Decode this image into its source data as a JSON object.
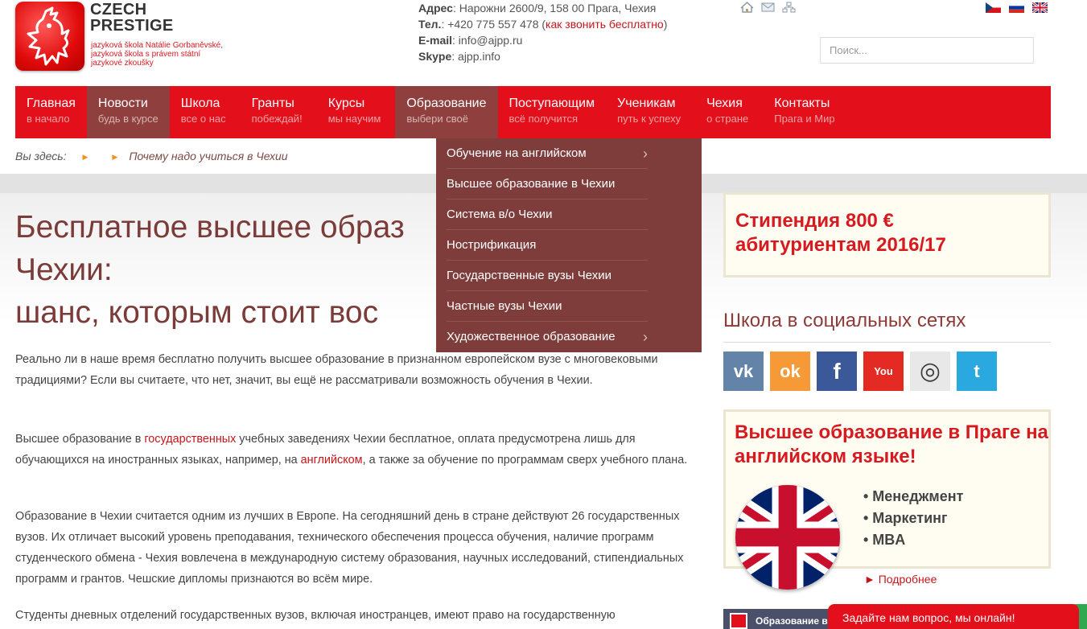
{
  "brand": {
    "line1": "CZECH",
    "line2": "PRESTIGE",
    "sub1": "jazyková škola Natálie Gorbaněvské,",
    "sub2": "jazyková škola s právem státní",
    "sub3": "jazykové zkoušky"
  },
  "contacts": {
    "address_label": "Адрес",
    ":address": "",
    "address": ": Нарожни 2600/9, 158 00 Прага, Чехия",
    "tel_label": "Тел.",
    "tel": ": +420 775 557 478 (",
    "tel_link": "как звонить бесплатно",
    "tel_end": ")",
    "email_label": "E-mail",
    "email": ": info@ajpp.ru",
    "skype_label": "Skype",
    "skype": ": ajpp.info"
  },
  "search": {
    "placeholder": "Поиск..."
  },
  "nav": [
    {
      "title": "Главная",
      "sub": "в начало"
    },
    {
      "title": "Новости",
      "sub": "будь в курсе"
    },
    {
      "title": "Школа",
      "sub": "все о нас"
    },
    {
      "title": "Гранты",
      "sub": "побеждай!"
    },
    {
      "title": "Курсы",
      "sub": "мы научим"
    },
    {
      "title": "Образование",
      "sub": "выбери своё"
    },
    {
      "title": "Поступающим",
      "sub": "всё получится"
    },
    {
      "title": "Ученикам",
      "sub": "путь к успеху"
    },
    {
      "title": "Чехия",
      "sub": "о стране"
    },
    {
      "title": "Контакты",
      "sub": "Прага и Мир"
    }
  ],
  "dropdown": [
    "Обучение на английском",
    "Высшее образование в Чехии",
    "Система в/о Чехии",
    "Нострификация",
    "Государственные вузы Чехии",
    "Частные вузы Чехии",
    "Художественное образование"
  ],
  "breadcrumb": {
    "label": "Вы здесь:",
    "current": "Почему надо учиться в Чехии"
  },
  "heading": {
    "line1": "Бесплатное высшее образ",
    "line2": "Чехии:",
    "line3": "шанс, которым стоит вос"
  },
  "paragraphs": {
    "p1": "Реально ли в наше время бесплатно получить высшее образование в признанном европейском вузе с многовековыми традициями? Если вы считаете, что нет, значит, вы ещё не рассматривали возможность обучения в Чехии.",
    "p2a": "Высшее образование в ",
    "p2link1": "государственных",
    "p2b": " учебных заведениях Чехии бесплатное, оплата предусмотрена лишь для обучающихся на иностранных языках, например, на ",
    "p2link2": "английском",
    "p2c": ", а также за обучение по программам сверх учебного плана.",
    "p3": "Образование в Чехии считается одним из лучших в Европе. На сегодняшний день в стране действуют 26 государственных вузов. Их отличает высокий уровень преподавания, технического обеспечения процесса обучения, наличие программ студенческого обмена - Чехия вовлечена в международную систему образования, научных исследований, стипендиальных программ и грантов. Чешские дипломы признаются во всём мире.",
    "p4": "Студенты дневных отделений государственных вузов, включая иностранцев, имеют право на государственную"
  },
  "promo1": {
    "line1": "Стипендия 800 €",
    "line2": "абитуриентам 2016/17"
  },
  "social": {
    "title": "Школа в социальных сетях",
    "icons": [
      "vk-icon",
      "odnoklassniki-icon",
      "facebook-icon",
      "youtube-icon",
      "instagram-icon",
      "twitter-icon"
    ],
    "glyphs": [
      "vk",
      "ok",
      "f",
      "You",
      "◎",
      "t"
    ],
    "colors": [
      "#6383a8",
      "#f59a36",
      "#3b5998",
      "#e32b24",
      "#3d3d3d",
      "#2aa9e0"
    ]
  },
  "promo2": {
    "title": "Высшее образование в Праге на английском языке!",
    "items": [
      "• Менеджмент",
      "• Маркетинг",
      "• MBA"
    ],
    "more": "► Подробнее"
  },
  "stub": {
    "text": "Образование в"
  },
  "chat": {
    "label": "Задайте нам вопрос, мы онлайн!"
  }
}
